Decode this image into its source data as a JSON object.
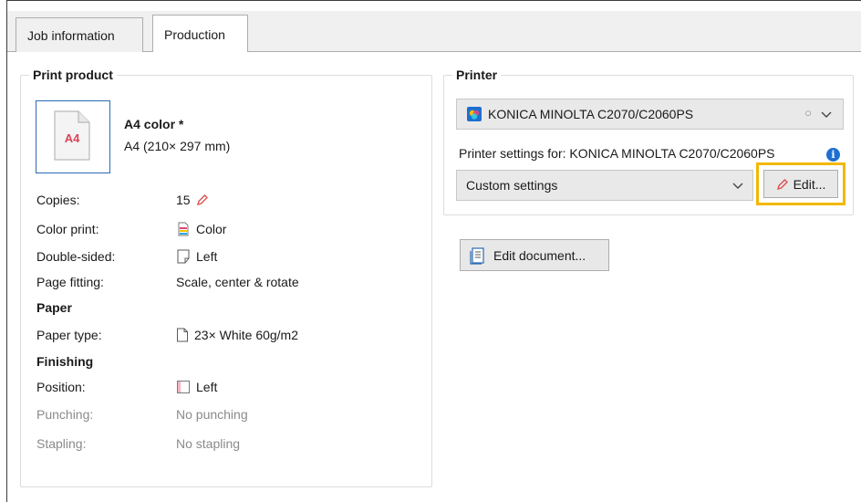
{
  "tabs": [
    {
      "label": "Job information",
      "active": false
    },
    {
      "label": "Production",
      "active": true
    }
  ],
  "print_product": {
    "group_title": "Print product",
    "thumbnail_text": "A4",
    "product_name": "A4 color *",
    "product_size": "A4 (210× 297 mm)",
    "rows": [
      {
        "label": "Copies:",
        "value": "15"
      },
      {
        "label": "Color print:",
        "value": "Color"
      },
      {
        "label": "Double-sided:",
        "value": "Left"
      },
      {
        "label": "Page fitting:",
        "value": "Scale, center & rotate"
      }
    ],
    "paper_heading": "Paper",
    "paper_rows": [
      {
        "label": "Paper type:",
        "value": "23× White 60g/m2"
      }
    ],
    "finishing_heading": "Finishing",
    "finishing_rows": [
      {
        "label": "Position:",
        "value": "Left"
      },
      {
        "label": "Punching:",
        "value": "No punching"
      },
      {
        "label": "Stapling:",
        "value": "No stapling"
      }
    ]
  },
  "printer": {
    "group_title": "Printer",
    "selected_printer": "KONICA MINOLTA C2070/C2060PS",
    "settings_label": "Printer settings for: KONICA MINOLTA C2070/C2060PS",
    "settings_value": "Custom settings",
    "edit_button": "Edit...",
    "info_icon_glyph": "i"
  },
  "edit_document_button": "Edit document...",
  "colors": {
    "highlight": "#f2b800",
    "pencil": "#d9534f",
    "info_blue": "#1e6fd0",
    "thumb_border": "#2a6bb5"
  },
  "icons": [
    "pencil-icon",
    "color-print-icon",
    "double-sided-icon",
    "paper-icon",
    "finishing-position-icon",
    "printer-icon",
    "info-icon",
    "chevron-down-icon",
    "edit-document-icon"
  ]
}
